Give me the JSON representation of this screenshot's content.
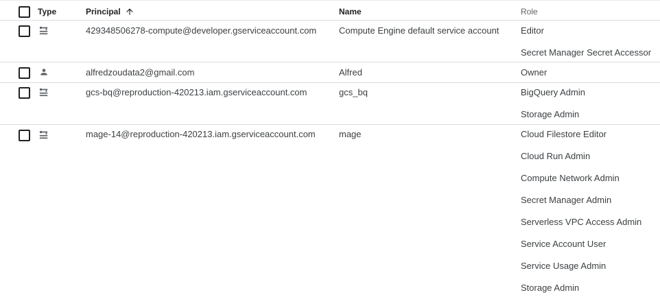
{
  "header": {
    "type_label": "Type",
    "principal_label": "Principal",
    "name_label": "Name",
    "role_label": "Role",
    "sort_icon": "arrow-upward-icon"
  },
  "rows": [
    {
      "type_icon": "service-account-icon",
      "principal": "429348506278-compute@developer.gserviceaccount.com",
      "name": "Compute Engine default service account",
      "roles": [
        "Editor",
        "Secret Manager Secret Accessor"
      ]
    },
    {
      "type_icon": "person-icon",
      "principal": "alfredzoudata2@gmail.com",
      "name": "Alfred",
      "roles": [
        "Owner"
      ]
    },
    {
      "type_icon": "service-account-icon",
      "principal": "gcs-bq@reproduction-420213.iam.gserviceaccount.com",
      "name": "gcs_bq",
      "roles": [
        "BigQuery Admin",
        "Storage Admin"
      ]
    },
    {
      "type_icon": "service-account-icon",
      "principal": "mage-14@reproduction-420213.iam.gserviceaccount.com",
      "name": "mage",
      "roles": [
        "Cloud Filestore Editor",
        "Cloud Run Admin",
        "Compute Network Admin",
        "Secret Manager Admin",
        "Serverless VPC Access Admin",
        "Service Account User",
        "Service Usage Admin",
        "Storage Admin"
      ]
    }
  ]
}
